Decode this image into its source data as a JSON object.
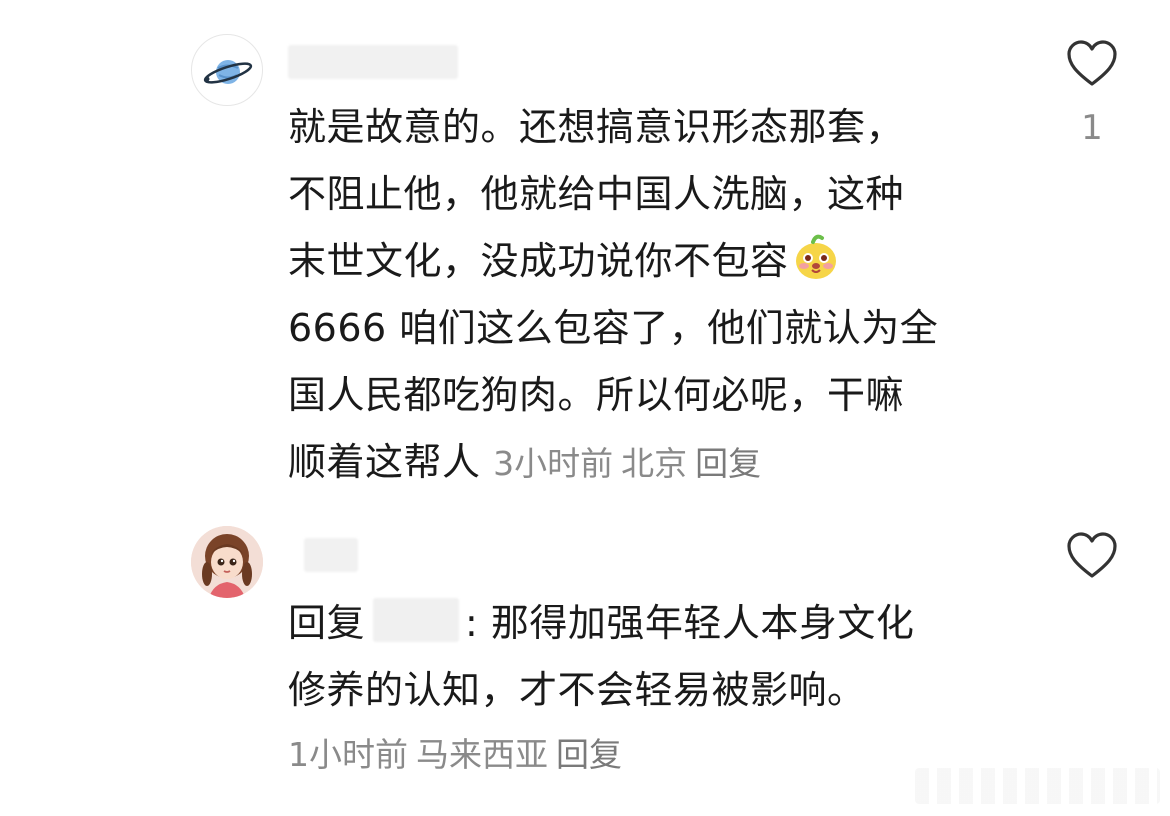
{
  "comments": [
    {
      "lines": [
        "就是故意的。还想搞意识形态那套，",
        "不阻止他，他就给中国人洗脑，这种",
        "末世文化，没成功说你不包容",
        "6666 咱们这么包容了，他们就认为全",
        "国人民都吃狗肉。所以何必呢，干嘛",
        "顺着这帮人"
      ],
      "time": "3小时前",
      "location": "北京",
      "reply_label": "回复",
      "like_count": "1",
      "avatar_icon": "saturn-planet-icon",
      "inline_emoji": "yellow-cartoon-face-emoji"
    },
    {
      "reply_prefix": "回复",
      "reply_suffix": ": 那得加强年轻人本身文化",
      "line2": "修养的认知，才不会轻易被影响。",
      "time": "1小时前",
      "location": "马来西亚",
      "reply_label": "回复",
      "avatar_icon": "cartoon-girl-avatar"
    }
  ],
  "colors": {
    "text": "#1a1a1a",
    "meta": "#8a8a8a",
    "background": "#ffffff"
  }
}
